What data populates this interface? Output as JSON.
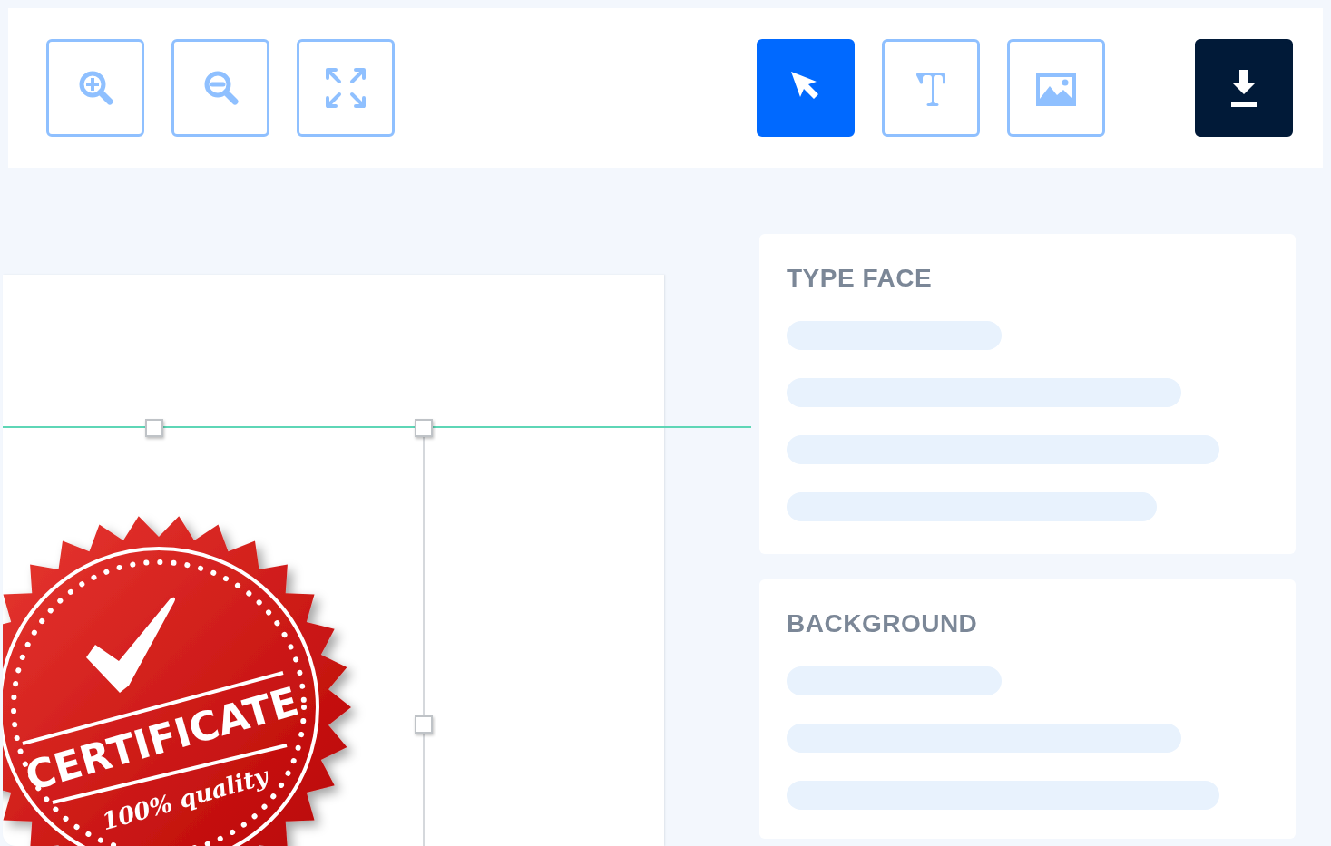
{
  "toolbar": {
    "tools": [
      {
        "kind": "zoom-in",
        "selected": false
      },
      {
        "kind": "zoom-out",
        "selected": false
      },
      {
        "kind": "fit",
        "selected": false
      },
      {
        "kind": "select",
        "selected": true
      },
      {
        "kind": "text",
        "selected": false
      },
      {
        "kind": "image",
        "selected": false
      },
      {
        "kind": "download"
      }
    ]
  },
  "canvas": {
    "seal": {
      "title": "CERTIFICATE",
      "subtitle": "100% quality"
    }
  },
  "panels": [
    {
      "title": "TYPE FACE"
    },
    {
      "title": "BACKGROUND"
    }
  ]
}
